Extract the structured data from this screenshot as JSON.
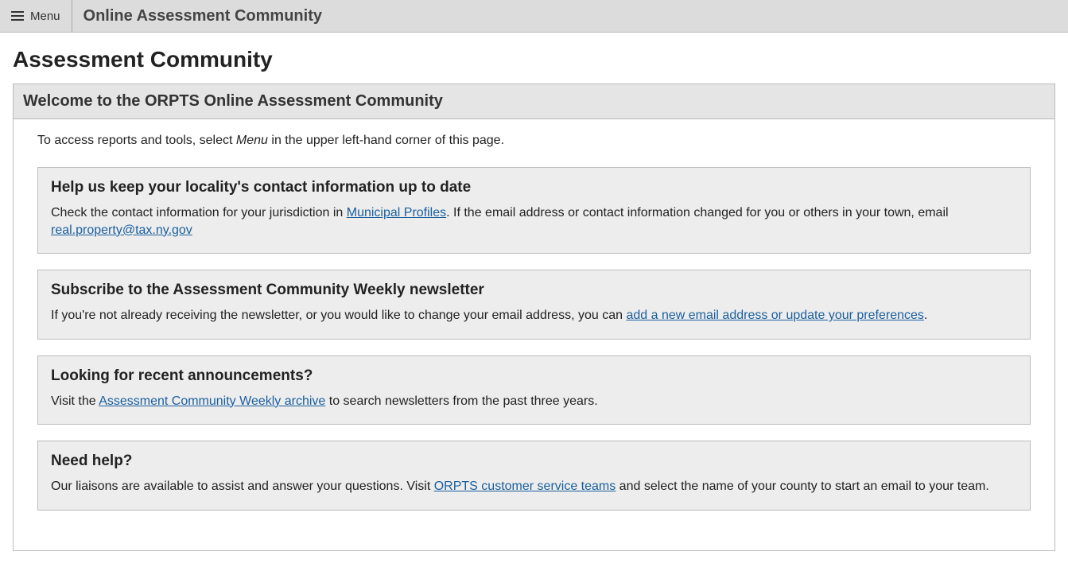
{
  "topbar": {
    "menu_label": "Menu",
    "site_title": "Online Assessment Community"
  },
  "page_heading": "Assessment Community",
  "panel_title": "Welcome to the ORPTS Online Assessment Community",
  "intro": {
    "pre": "To access reports and tools, select ",
    "emph": "Menu",
    "post": " in the upper left-hand corner of this page."
  },
  "box1": {
    "title": "Help us keep your locality's contact information up to date",
    "t1": "Check the contact information for your jurisdiction in ",
    "link1": "Municipal Profiles",
    "t2": ". If the email address or contact information changed for you or others in your town, email ",
    "link2": "real.property@tax.ny.gov"
  },
  "box2": {
    "title": "Subscribe to the Assessment Community Weekly newsletter",
    "t1": "If you're not already receiving the newsletter, or you would like to change your email address, you can ",
    "link1": "add a new email address or update your preferences",
    "t2": "."
  },
  "box3": {
    "title": "Looking for recent announcements?",
    "t1": "Visit the ",
    "link1": "Assessment Community Weekly archive",
    "t2": " to search newsletters from the past three years."
  },
  "box4": {
    "title": "Need help?",
    "t1": "Our liaisons are available to assist and answer your questions. Visit ",
    "link1": "ORPTS customer service teams",
    "t2": " and select the name of your county to start an email to your team."
  }
}
